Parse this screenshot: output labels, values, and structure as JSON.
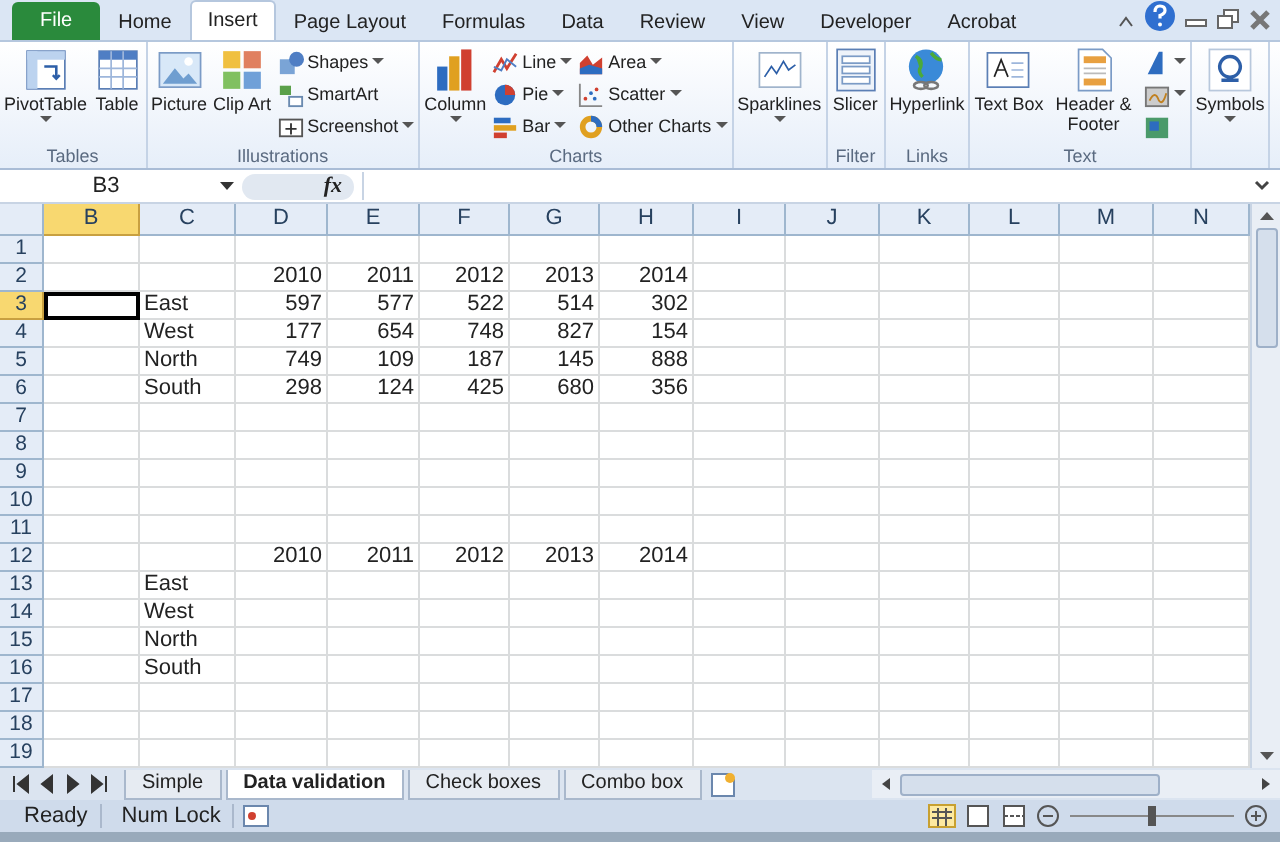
{
  "tabs": [
    {
      "label": "File",
      "kind": "file",
      "selected": false
    },
    {
      "label": "Home",
      "kind": "tab",
      "selected": false
    },
    {
      "label": "Insert",
      "kind": "tab",
      "selected": true
    },
    {
      "label": "Page Layout",
      "kind": "tab",
      "selected": false
    },
    {
      "label": "Formulas",
      "kind": "tab",
      "selected": false
    },
    {
      "label": "Data",
      "kind": "tab",
      "selected": false
    },
    {
      "label": "Review",
      "kind": "tab",
      "selected": false
    },
    {
      "label": "View",
      "kind": "tab",
      "selected": false
    },
    {
      "label": "Developer",
      "kind": "tab",
      "selected": false
    },
    {
      "label": "Acrobat",
      "kind": "tab",
      "selected": false
    }
  ],
  "ribbon_groups": [
    {
      "label": "Tables",
      "items": [
        {
          "label": "PivotTable",
          "kind": "large",
          "dropdown": true
        },
        {
          "label": "Table",
          "kind": "large",
          "dropdown": false
        }
      ]
    },
    {
      "label": "Illustrations",
      "items": [
        {
          "label": "Picture",
          "kind": "large",
          "dropdown": false
        },
        {
          "label": "Clip Art",
          "kind": "large",
          "dropdown": false
        },
        {
          "label": "Shapes",
          "kind": "small",
          "dropdown": true
        },
        {
          "label": "SmartArt",
          "kind": "small",
          "dropdown": false
        },
        {
          "label": "Screenshot",
          "kind": "small",
          "dropdown": true
        }
      ]
    },
    {
      "label": "Charts",
      "items": [
        {
          "label": "Column",
          "kind": "large",
          "dropdown": true
        },
        {
          "label": "Line",
          "kind": "small",
          "dropdown": true
        },
        {
          "label": "Pie",
          "kind": "small",
          "dropdown": true
        },
        {
          "label": "Bar",
          "kind": "small",
          "dropdown": true
        },
        {
          "label": "Area",
          "kind": "small",
          "dropdown": true
        },
        {
          "label": "Scatter",
          "kind": "small",
          "dropdown": true
        },
        {
          "label": "Other Charts",
          "kind": "small",
          "dropdown": true
        }
      ]
    },
    {
      "items": [
        {
          "label": "Sparklines",
          "kind": "large",
          "dropdown": true
        }
      ]
    },
    {
      "label": "Filter",
      "items": [
        {
          "label": "Slicer",
          "kind": "large",
          "dropdown": false
        }
      ]
    },
    {
      "label": "Links",
      "items": [
        {
          "label": "Hyperlink",
          "kind": "large",
          "dropdown": false
        }
      ]
    },
    {
      "label": "Text",
      "items": [
        {
          "label": "Text Box",
          "kind": "large",
          "dropdown": false
        },
        {
          "label": "Header & Footer",
          "kind": "large",
          "dropdown": false
        },
        {
          "kind": "icon",
          "dropdown": true
        },
        {
          "kind": "icon",
          "dropdown": true
        },
        {
          "kind": "icon",
          "dropdown": false
        }
      ]
    },
    {
      "items": [
        {
          "label": "Symbols",
          "kind": "large",
          "dropdown": true
        }
      ]
    }
  ],
  "name_box": "B3",
  "formula_label": "fx",
  "columns": [
    {
      "label": "B",
      "selected": true
    },
    {
      "label": "C",
      "selected": false
    },
    {
      "label": "D",
      "selected": false
    },
    {
      "label": "E",
      "selected": false
    },
    {
      "label": "F",
      "selected": false
    },
    {
      "label": "G",
      "selected": false
    },
    {
      "label": "H",
      "selected": false
    },
    {
      "label": "I",
      "selected": false
    },
    {
      "label": "J",
      "selected": false
    },
    {
      "label": "K",
      "selected": false
    },
    {
      "label": "L",
      "selected": false
    },
    {
      "label": "M",
      "selected": false
    },
    {
      "label": "N",
      "selected": false
    }
  ],
  "rows": [
    {
      "number": "1",
      "selected": false
    },
    {
      "number": "2",
      "selected": false,
      "values": [
        "2010",
        "2011",
        "2012",
        "2013",
        "2014"
      ]
    },
    {
      "number": "3",
      "selected": true,
      "label": "East",
      "values": [
        "597",
        "577",
        "522",
        "514",
        "302"
      ]
    },
    {
      "number": "4",
      "selected": false,
      "label": "West",
      "values": [
        "177",
        "654",
        "748",
        "827",
        "154"
      ]
    },
    {
      "number": "5",
      "selected": false,
      "label": "North",
      "values": [
        "749",
        "109",
        "187",
        "145",
        "888"
      ]
    },
    {
      "number": "6",
      "selected": false,
      "label": "South",
      "values": [
        "298",
        "124",
        "425",
        "680",
        "356"
      ]
    },
    {
      "number": "7",
      "selected": false
    },
    {
      "number": "8",
      "selected": false
    },
    {
      "number": "9",
      "selected": false
    },
    {
      "number": "10",
      "selected": false
    },
    {
      "number": "11",
      "selected": false
    },
    {
      "number": "12",
      "selected": false,
      "values": [
        "2010",
        "2011",
        "2012",
        "2013",
        "2014"
      ]
    },
    {
      "number": "13",
      "selected": false,
      "label": "East"
    },
    {
      "number": "14",
      "selected": false,
      "label": "West"
    },
    {
      "number": "15",
      "selected": false,
      "label": "North"
    },
    {
      "number": "16",
      "selected": false,
      "label": "South"
    },
    {
      "number": "17",
      "selected": false
    },
    {
      "number": "18",
      "selected": false
    },
    {
      "number": "19",
      "selected": false
    }
  ],
  "sheet_tabs": [
    {
      "label": "Simple",
      "selected": false
    },
    {
      "label": "Data validation",
      "selected": true
    },
    {
      "label": "Check boxes",
      "selected": false
    },
    {
      "label": "Combo box",
      "selected": false
    }
  ],
  "status_bar": [
    "Ready",
    "Num Lock"
  ],
  "zoom": {
    "level": 0.5
  }
}
